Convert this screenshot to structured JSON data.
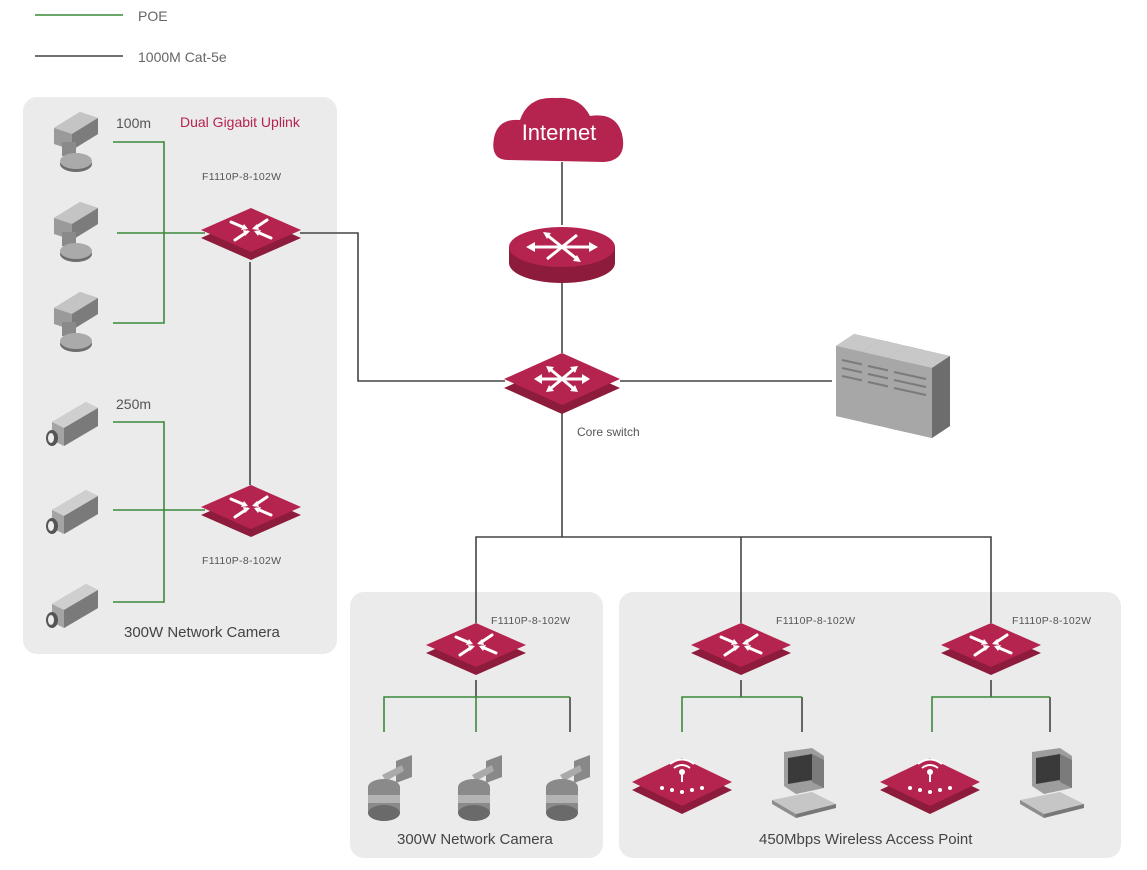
{
  "legend": {
    "poe_label": "POE",
    "cat5e_label": "1000M Cat-5e",
    "poe_color": "#3a8a3a",
    "cat5e_color": "#444444"
  },
  "colors": {
    "brand": "#b5234f",
    "group_bg": "#ebebeb"
  },
  "internet": {
    "label": "Internet"
  },
  "core": {
    "label": "Core switch"
  },
  "left_group": {
    "uplink_label": "Dual Gigabit Uplink",
    "top_distance": "100m",
    "bottom_distance": "250m",
    "top_switch_model": "F1110P-8-102W",
    "bottom_switch_model": "F1110P-8-102W",
    "caption": "300W Network Camera"
  },
  "bottom_left_group": {
    "switch_model": "F1110P-8-102W",
    "caption": "300W Network Camera"
  },
  "bottom_right_group": {
    "switch1_model": "F1110P-8-102W",
    "switch2_model": "F1110P-8-102W",
    "caption": "450Mbps Wireless Access Point"
  },
  "icons": [
    "cloud-icon",
    "router-icon",
    "switch-icon",
    "server-icon",
    "bullet-camera-icon",
    "box-camera-icon",
    "dome-camera-icon",
    "access-point-icon",
    "computer-icon"
  ]
}
